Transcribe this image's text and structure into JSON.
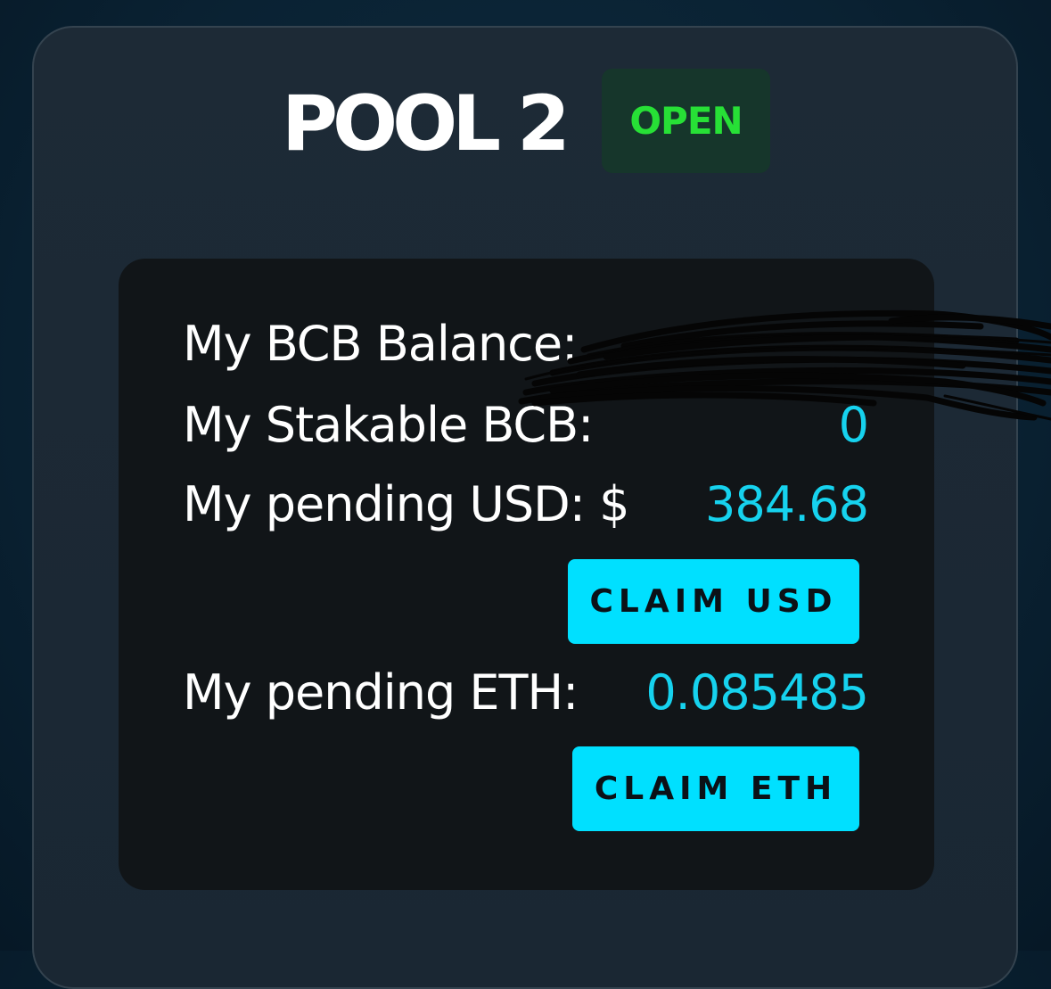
{
  "pool": {
    "title": "POOL 2",
    "status": "OPEN",
    "status_color": "#27e036",
    "accent_color": "#00e0ff",
    "value_color": "#16d2ee"
  },
  "stats": {
    "bcb_balance_label": "My BCB Balance:",
    "stakable_bcb_label": "My Stakable BCB:",
    "stakable_bcb_value": "0",
    "pending_usd_label": "My pending USD: $",
    "pending_usd_value": "384.68",
    "pending_eth_label": "My pending ETH:",
    "pending_eth_value": "0.085485"
  },
  "actions": {
    "claim_usd_label": "CLAIM USD",
    "claim_eth_label": "CLAIM ETH"
  }
}
